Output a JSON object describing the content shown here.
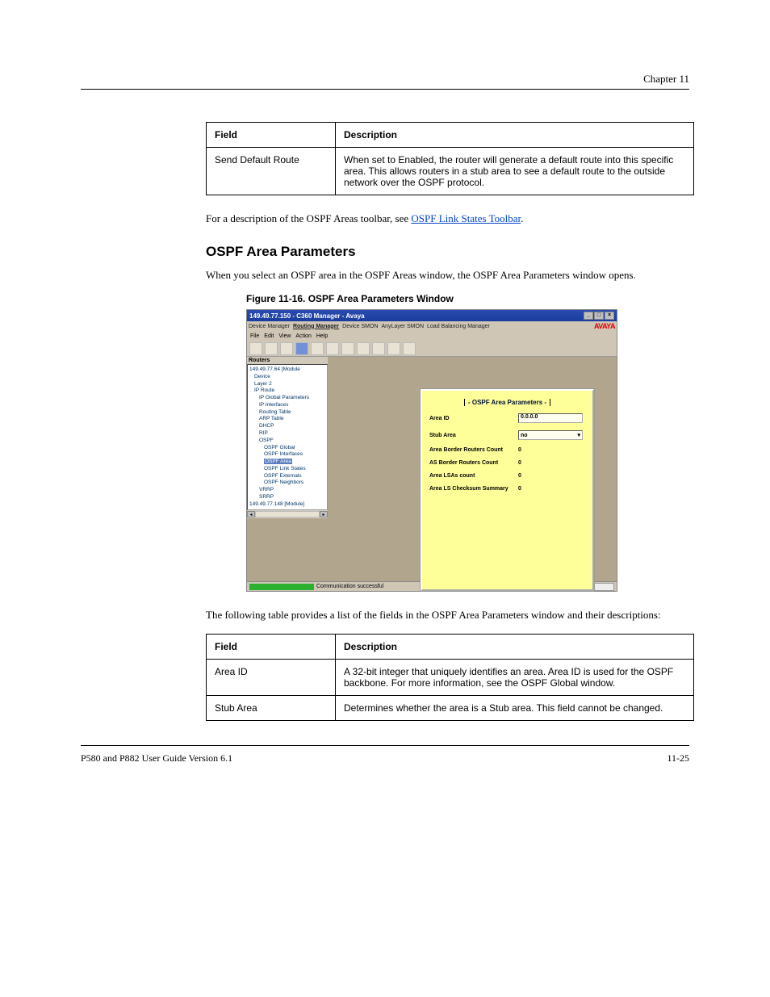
{
  "header": {
    "chapter": "Chapter 11"
  },
  "tables": {
    "first": {
      "rows": [
        {
          "field": "Field",
          "desc": "Description"
        },
        {
          "field": "Send Default Route",
          "desc": "When set to Enabled, the router will generate a default route into this specific area. This allows routers in a stub area to see a default route to the outside network over the OSPF protocol."
        }
      ]
    },
    "second": {
      "rows": [
        {
          "field": "Field",
          "desc": "Description"
        },
        {
          "field": "Area ID",
          "desc": "A 32-bit integer that uniquely identifies an area. Area ID is used for the OSPF backbone. For more information, see the OSPF Global window."
        },
        {
          "field": "Stub Area",
          "desc": "Determines whether the area is a Stub area. This field cannot be changed."
        }
      ]
    }
  },
  "paras": {
    "p1_a": "For a description of the OSPF Areas toolbar, see ",
    "p1_link": "OSPF Link States Toolbar",
    "p1_b": ".",
    "p2": "OSPF Area Parameters",
    "p3": "When you select an OSPF area in the OSPF Areas window, the OSPF Area Parameters window opens.",
    "p4": "The following table provides a list of the fields in the OSPF Area Parameters window and their descriptions:"
  },
  "figure": {
    "caption": "Figure 11-16. OSPF Area Parameters Window"
  },
  "app": {
    "title": "149.49.77.150 - C360 Manager - Avaya",
    "window_controls": {
      "min": "_",
      "max": "□",
      "close": "×"
    },
    "tabs": [
      "Device Manager",
      "Routing Manager",
      "Device SMON",
      "AnyLayer SMON",
      "Load Balancing Manager"
    ],
    "menus": [
      "File",
      "Edit",
      "View",
      "Action",
      "Help"
    ],
    "tree_header": "Routers",
    "tree": [
      "149.49.77.64 [Module",
      "Device",
      "Layer 2",
      "IP Route",
      "IP Global Parameters",
      "IP Interfaces",
      "Routing Table",
      "ARP Table",
      "DHCP",
      "RIP",
      "OSPF",
      "OSPF Global",
      "OSPF Interfaces",
      "OSPF Area",
      "OSPF Link States",
      "OSPF Externals",
      "OSPF Neighbors",
      "VRRP",
      "SRRP",
      "149.49.77.148 [Module]"
    ],
    "panel": {
      "title": "- OSPF Area Parameters -",
      "rows": {
        "area_id_label": "Area ID",
        "area_id_value": "0.0.0.0",
        "stub_label": "Stub Area",
        "stub_value": "no",
        "abr_label": "Area Border Routers Count",
        "abr_value": "0",
        "asbr_label": "AS Border Routers Count",
        "asbr_value": "0",
        "lsa_label": "Area LSAs count",
        "lsa_value": "0",
        "cksum_label": "Area LS Checksum Summary",
        "cksum_value": "0"
      }
    },
    "status": "Communication successful",
    "logo": "AVAYA"
  },
  "footer": {
    "left": "P580 and P882 User Guide Version 6.1",
    "right": "11-25"
  }
}
